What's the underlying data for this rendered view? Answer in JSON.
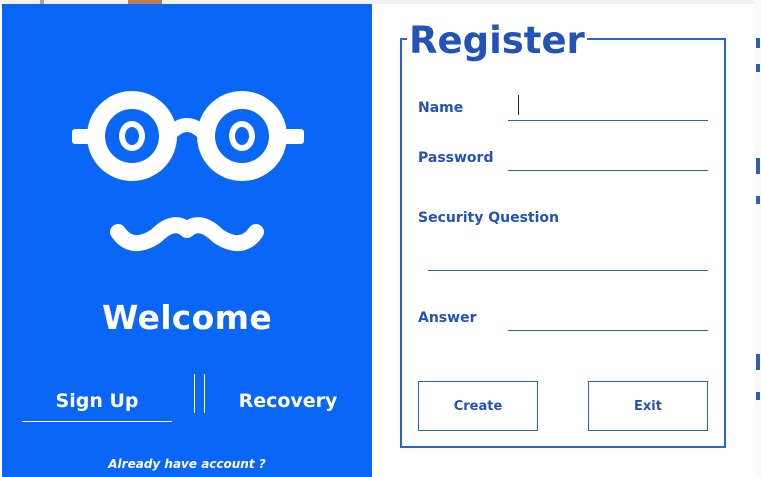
{
  "left": {
    "welcome": "Welcome",
    "tabs": {
      "signup": "Sign Up",
      "recovery": "Recovery"
    },
    "footer_link": "Already have account ?"
  },
  "register": {
    "title": "Register",
    "fields": {
      "name": {
        "label": "Name",
        "value": ""
      },
      "password": {
        "label": "Password",
        "value": ""
      },
      "security_question": {
        "label": "Security Question",
        "value": ""
      },
      "answer": {
        "label": "Answer",
        "value": ""
      }
    },
    "buttons": {
      "create": "Create",
      "exit": "Exit"
    }
  },
  "colors": {
    "panel_blue": "#0a66f7",
    "accent_blue": "#2352b8",
    "white": "#ffffff"
  },
  "icons": {
    "logo": "glasses-mustache-icon"
  }
}
